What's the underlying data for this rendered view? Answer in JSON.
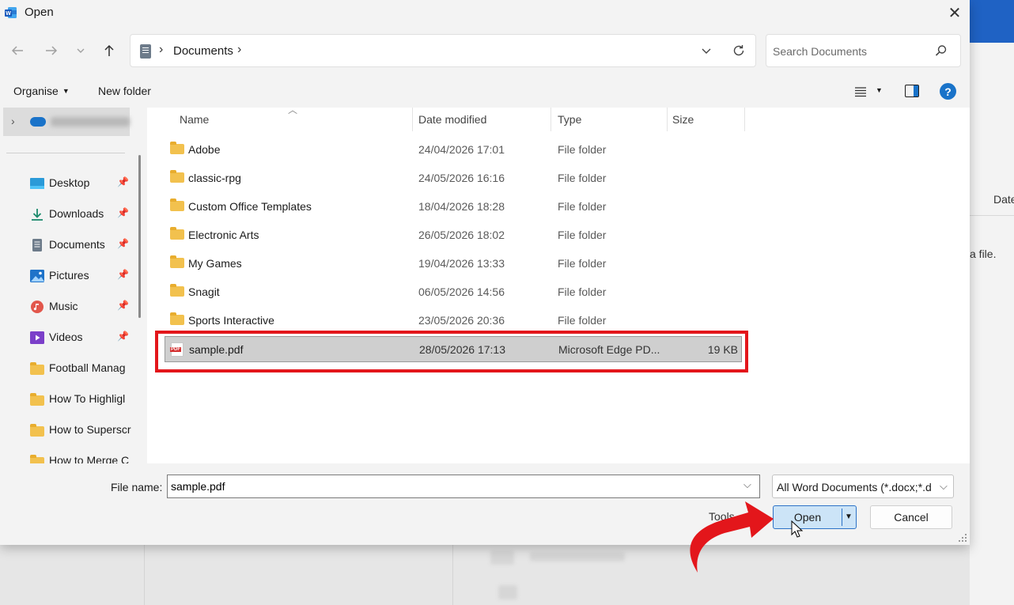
{
  "window": {
    "title": "Open",
    "close_label": "✕"
  },
  "background": {
    "date_header": "Date",
    "hint_text": "a file."
  },
  "nav": {
    "back_icon": "arrow-left",
    "forward_icon": "arrow-right",
    "recent_icon": "chevron-down",
    "up_icon": "arrow-up",
    "breadcrumb": "Documents",
    "search_placeholder": "Search Documents"
  },
  "toolbar": {
    "organise_label": "Organise",
    "new_folder_label": "New folder",
    "help_label": "?"
  },
  "sidebar": {
    "items": [
      {
        "label": "Desktop",
        "icon": "desktop-icon",
        "pinned": true
      },
      {
        "label": "Downloads",
        "icon": "download-icon",
        "pinned": true
      },
      {
        "label": "Documents",
        "icon": "documents-icon",
        "pinned": true
      },
      {
        "label": "Pictures",
        "icon": "pictures-icon",
        "pinned": true
      },
      {
        "label": "Music",
        "icon": "music-icon",
        "pinned": true
      },
      {
        "label": "Videos",
        "icon": "videos-icon",
        "pinned": true
      },
      {
        "label": "Football Manag",
        "icon": "folder-icon",
        "pinned": false
      },
      {
        "label": "How To Highligl",
        "icon": "folder-icon",
        "pinned": false
      },
      {
        "label": "How to Superscr",
        "icon": "folder-icon",
        "pinned": false
      },
      {
        "label": "How to Merge C",
        "icon": "folder-icon",
        "pinned": false
      }
    ]
  },
  "filelist": {
    "columns": [
      "Name",
      "Date modified",
      "Type",
      "Size"
    ],
    "rows": [
      {
        "name": "Adobe",
        "date": "24/04/2026 17:01",
        "type": "File folder",
        "size": ""
      },
      {
        "name": "classic-rpg",
        "date": "24/05/2026 16:16",
        "type": "File folder",
        "size": ""
      },
      {
        "name": "Custom Office Templates",
        "date": "18/04/2026 18:28",
        "type": "File folder",
        "size": ""
      },
      {
        "name": "Electronic Arts",
        "date": "26/05/2026 18:02",
        "type": "File folder",
        "size": ""
      },
      {
        "name": "My Games",
        "date": "19/04/2026 13:33",
        "type": "File folder",
        "size": ""
      },
      {
        "name": "Snagit",
        "date": "06/05/2026 14:56",
        "type": "File folder",
        "size": ""
      },
      {
        "name": "Sports Interactive",
        "date": "23/05/2026 20:36",
        "type": "File folder",
        "size": ""
      },
      {
        "name": "sample.pdf",
        "date": "28/05/2026 17:13",
        "type": "Microsoft Edge PD...",
        "size": "19 KB"
      }
    ],
    "pdf_badge": "PDF"
  },
  "bottom": {
    "file_name_label": "File name:",
    "file_name_value": "sample.pdf",
    "filter_value": "All Word Documents (*.docx;*.d",
    "tools_label": "Tools",
    "open_label": "Open",
    "cancel_label": "Cancel"
  },
  "colors": {
    "highlight": "#e3161b",
    "accent": "#1a73c9",
    "open_button_bg": "#cce4f7"
  }
}
